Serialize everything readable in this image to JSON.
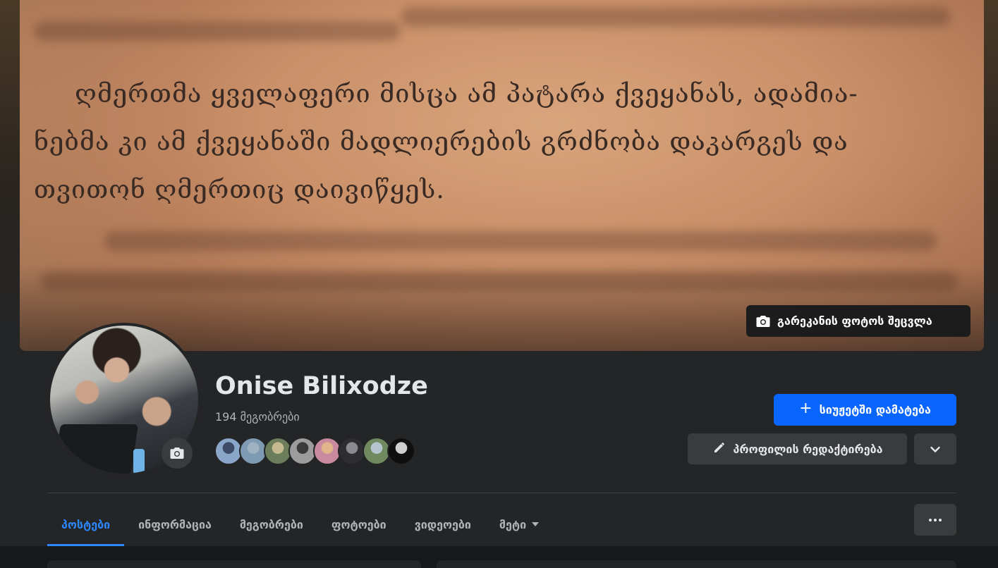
{
  "cover": {
    "text_lines": [
      "ღმერთმა ყველაფერი მისცა ამ პატარა ქვეყანას, ადამია-",
      "ნებმა კი ამ ქვეყანაში მადლიერების გრძნობა დაკარგეს და",
      "თვითონ ღმერთიც დაივიწყეს."
    ],
    "change_button_label": "გარეკანის ფოტოს შეცვლა",
    "change_button_icon": "camera-icon"
  },
  "profile": {
    "name": "Onise Bilixodze",
    "friends_count": "194 მეგობრები",
    "avatar_camera_icon": "camera-icon",
    "friend_avatars": [
      {
        "color_a": "#8aa6c9",
        "color_b": "#3c4c66"
      },
      {
        "color_a": "#7f9bb3",
        "color_b": "#9fb2c1"
      },
      {
        "color_a": "#6b7d5a",
        "color_b": "#c7b98f"
      },
      {
        "color_a": "#9c9c9c",
        "color_b": "#3b3b3b"
      },
      {
        "color_a": "#c98aa0",
        "color_b": "#e2b48c"
      },
      {
        "color_a": "#2e2e32",
        "color_b": "#8a8a90"
      },
      {
        "color_a": "#6e8a5e",
        "color_b": "#b5c4cf"
      },
      {
        "color_a": "#0f0f10",
        "color_b": "#cfcfcf"
      }
    ]
  },
  "actions": {
    "add_to_story": "სიუჟეტში დამატება",
    "add_to_story_icon": "plus-icon",
    "edit_profile": "პროფილის რედაქტირება",
    "edit_profile_icon": "pencil-icon",
    "dropdown_icon": "chevron-down-icon"
  },
  "tabs": [
    {
      "label": "პოსტები",
      "active": true
    },
    {
      "label": "ინფორმაცია",
      "active": false
    },
    {
      "label": "მეგობრები",
      "active": false
    },
    {
      "label": "ფოტოები",
      "active": false
    },
    {
      "label": "ვიდეოები",
      "active": false
    },
    {
      "label": "მეტი",
      "active": false,
      "has_caret": true
    }
  ],
  "more_button_icon": "ellipsis-icon",
  "colors": {
    "accent": "#2d88ff",
    "primary_button": "#0866ff",
    "surface": "#242526",
    "button_gray": "#3a3b3c",
    "page_bg": "#18191a"
  }
}
